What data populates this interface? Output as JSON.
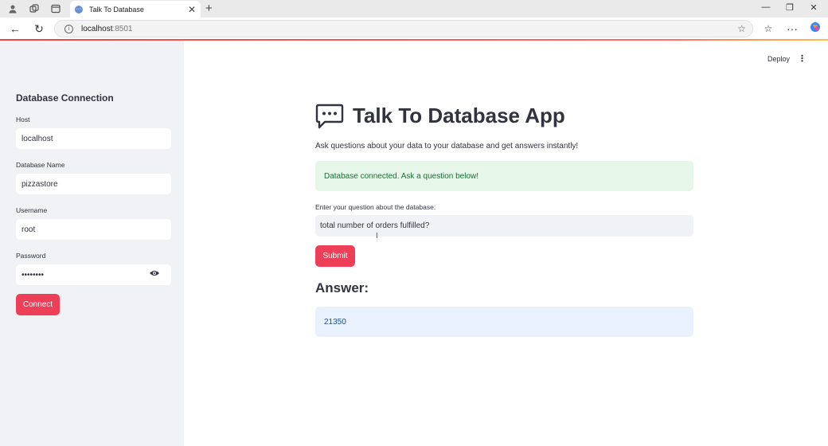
{
  "browser": {
    "tab_title": "Talk To Database",
    "tab_close": "✕",
    "new_tab": "+",
    "url_host": "localhost",
    "url_port": ":8501",
    "window_controls": [
      "—",
      "❐",
      "✕"
    ],
    "icons": [
      "profile-icon",
      "workspaces-icon",
      "tab-actions-icon",
      "back-icon",
      "reload-icon",
      "info-icon",
      "star-icon",
      "favorites-icon",
      "more-icon",
      "copilot-icon"
    ]
  },
  "header": {
    "deploy_label": "Deploy",
    "menu_label": "⋮"
  },
  "sidebar": {
    "title": "Database Connection",
    "fields": {
      "host": {
        "label": "Host",
        "value": "localhost"
      },
      "database": {
        "label": "Database Name",
        "value": "pizzastore"
      },
      "username": {
        "label": "Username",
        "value": "root"
      },
      "password": {
        "label": "Password",
        "value": "••••••••"
      }
    },
    "connect_label": "Connect"
  },
  "main": {
    "title": "Talk To Database App",
    "subtitle": "Ask questions about your data to your database and get answers instantly!",
    "success_message": "Database connected. Ask a question below!",
    "question_label": "Enter your question about the database:",
    "question_value": "total number of orders fulfilled?",
    "submit_label": "Submit",
    "answer_heading": "Answer:",
    "answer_value": "21350"
  },
  "colors": {
    "accent": "#ee3f58",
    "sidebar_bg": "#f0f2f6",
    "success_bg": "#e6f7e9",
    "info_bg": "#e8f1fc"
  }
}
